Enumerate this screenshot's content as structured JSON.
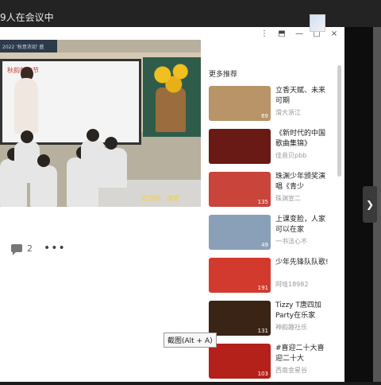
{
  "topbar": {
    "title": "9人在会议中"
  },
  "window_controls": [
    "⋮",
    "⬒",
    "—",
    "□",
    "×"
  ],
  "video": {
    "banner_text": "2022 '秋意浓如' 盛",
    "screen_text": "秋韵新章节",
    "caption_text": "欢迎你、课堂"
  },
  "actions": {
    "comment_count": "2",
    "more": "•••"
  },
  "recommend": {
    "title": "更多推荐",
    "items": [
      {
        "title": "立香天赋、未来可期",
        "author": "滑大浙江",
        "count": "69",
        "color": "#b89468"
      },
      {
        "title": "《新时代的中国歌曲集锦》",
        "author": "佳音贝pbb",
        "count": "",
        "color": "#6a1a14"
      },
      {
        "title": "珠渊少年颁奖演唱《青少",
        "author": "珠渊宣二",
        "count": "135",
        "color": "#c9443a"
      },
      {
        "title": "上课变脸，人家可以在家",
        "author": "一书法心不",
        "count": "49",
        "color": "#8aa0b8"
      },
      {
        "title": "少年先锋队队歌!",
        "author": "阿哇18982",
        "count": "191",
        "color": "#d23a2e"
      },
      {
        "title": "Tizzy T唐四加Party在乐家",
        "author": "神韵趣社乐",
        "count": "131",
        "color": "#3a2416"
      },
      {
        "title": "#喜迎二十大喜迎二十大",
        "author": "西南金星谷",
        "count": "103",
        "color": "#b4201a"
      }
    ]
  },
  "tooltip": {
    "text": "截图(Alt + A)"
  },
  "next_icon": "❯"
}
